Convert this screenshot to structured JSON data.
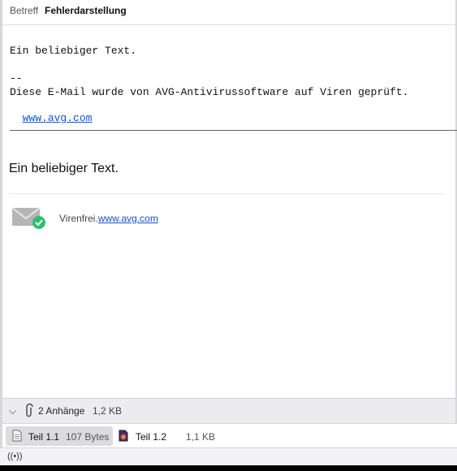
{
  "header": {
    "subject_label": "Betreff",
    "subject_value": "Fehlerdarstellung"
  },
  "body": {
    "line1": "Ein beliebiger Text.",
    "sig_sep": "--",
    "sig_text": "Diese E-Mail wurde von AVG-Antivirussoftware auf Viren geprüft.",
    "sig_link": "www.avg.com",
    "html_text": "Ein beliebiger Text.",
    "virus_label": "Virenfrei.",
    "virus_link": "www.avg.com"
  },
  "attachments": {
    "count_label": "2 Anhänge",
    "total_size": "1,2 KB",
    "items": [
      {
        "name": "Teil 1.1",
        "size": "107 Bytes",
        "icon": "text-file-icon"
      },
      {
        "name": "Teil 1.2",
        "size": "1,1 KB",
        "icon": "html-file-icon"
      }
    ]
  },
  "status": {
    "icon": "connection-status-icon"
  },
  "colors": {
    "link": "#0b57d0",
    "check_green": "#2fbf71",
    "selected_bg": "#dcdce0"
  }
}
